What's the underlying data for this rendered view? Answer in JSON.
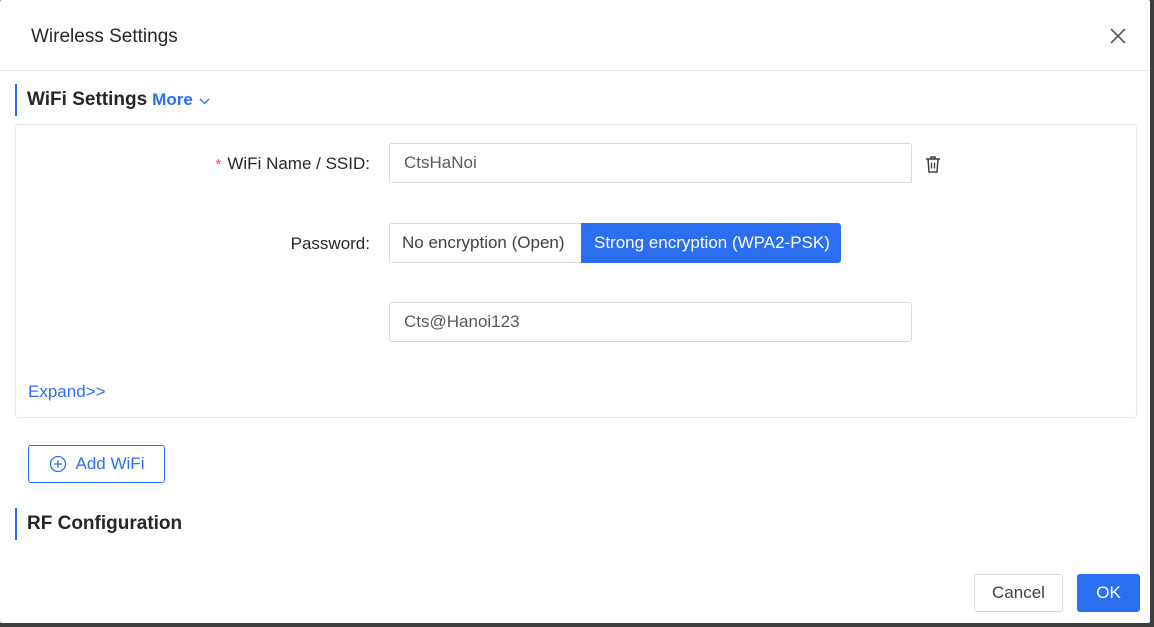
{
  "dialog": {
    "title": "Wireless Settings"
  },
  "wifi_section": {
    "title": "WiFi Settings",
    "more_label": "More",
    "ssid_label": "WiFi Name / SSID",
    "ssid_required_mark": "*",
    "ssid_value": "CtsHaNoi",
    "password_label": "Password",
    "label_colon": ":",
    "encryption_options": [
      "No encryption (Open)",
      "Strong encryption (WPA2-PSK)"
    ],
    "encryption_selected": "Strong encryption (WPA2-PSK)",
    "password_value": "Cts@Hanoi123",
    "expand_label": "Expand>>"
  },
  "add_wifi_label": "Add WiFi",
  "rf_section": {
    "title": "RF Configuration"
  },
  "footer": {
    "cancel_label": "Cancel",
    "ok_label": "OK"
  },
  "colors": {
    "accent": "#2b6ff0",
    "required": "#e84a4a"
  },
  "icons": {
    "close": "close-icon",
    "chevron": "chevron-down-icon",
    "trash": "trash-icon",
    "add": "plus-circle-icon"
  }
}
